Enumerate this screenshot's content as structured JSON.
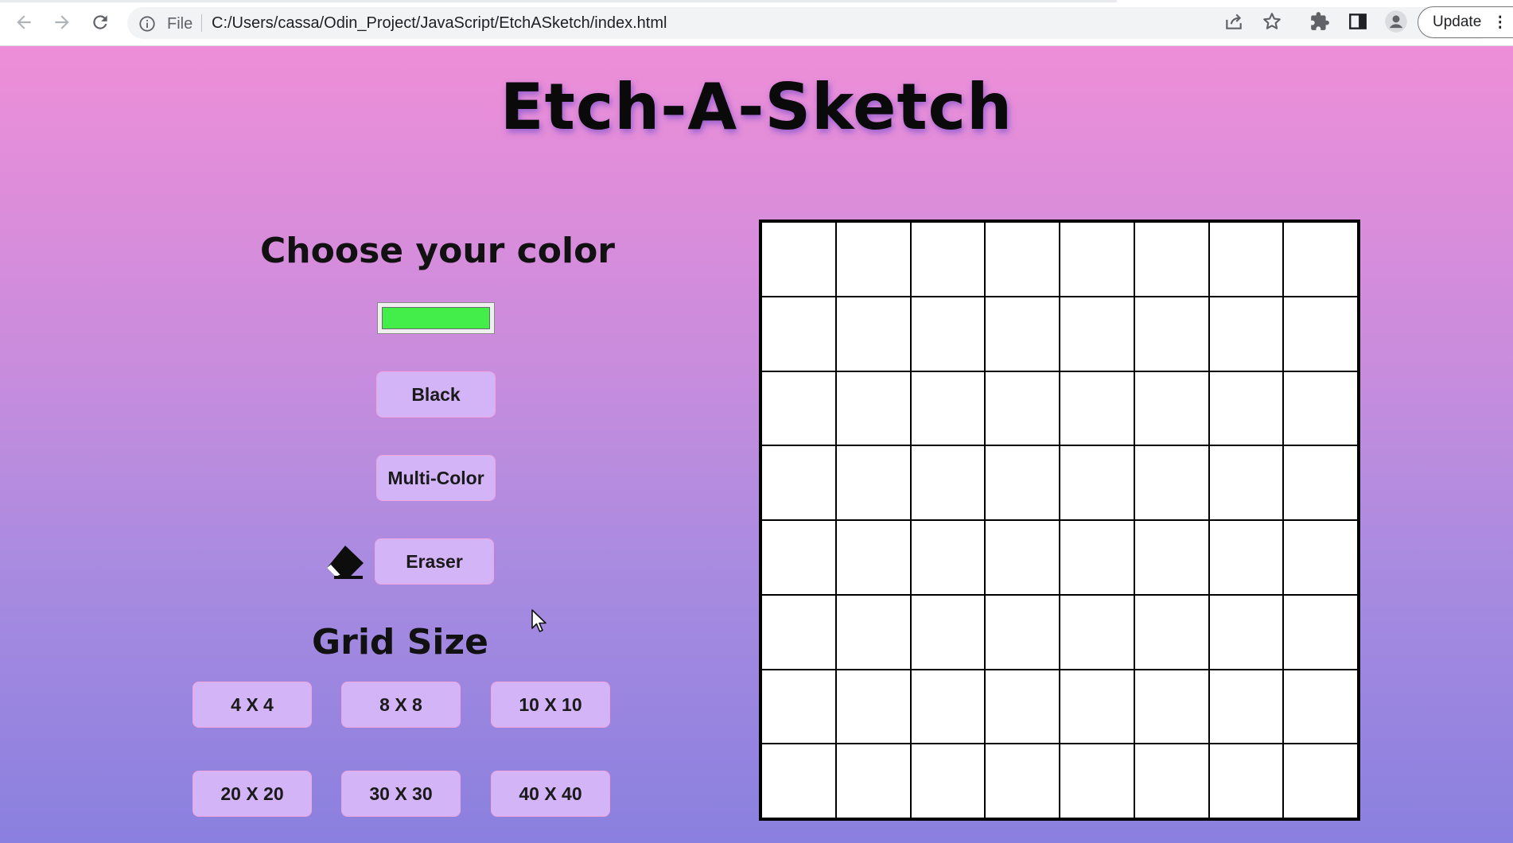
{
  "browser": {
    "scheme_label": "File",
    "url": "C:/Users/cassa/Odin_Project/JavaScript/EtchASketch/index.html",
    "update_label": "Update",
    "icons": [
      "back-icon",
      "forward-icon",
      "reload-icon",
      "info-icon",
      "share-icon",
      "star-icon",
      "extensions-icon",
      "side-panel-icon",
      "profile-icon",
      "menu-icon"
    ]
  },
  "page": {
    "title": "Etch-A-Sketch",
    "choose_color_heading": "Choose your color",
    "selected_color": "#44ee4a",
    "buttons": {
      "black": "Black",
      "multicolor": "Multi-Color",
      "eraser": "Eraser"
    },
    "grid_size_heading": "Grid Size",
    "grid_size_options": [
      "4 X 4",
      "8 X 8",
      "10 X 10",
      "20 X 20",
      "30 X 30",
      "40 X 40"
    ],
    "current_grid": {
      "rows": 8,
      "cols": 8
    }
  },
  "colors": {
    "button_bg": "#d3b4f7",
    "button_border": "#f2a4dc",
    "gradient_top": "#ee8ed8",
    "gradient_bottom": "#8a80df"
  }
}
